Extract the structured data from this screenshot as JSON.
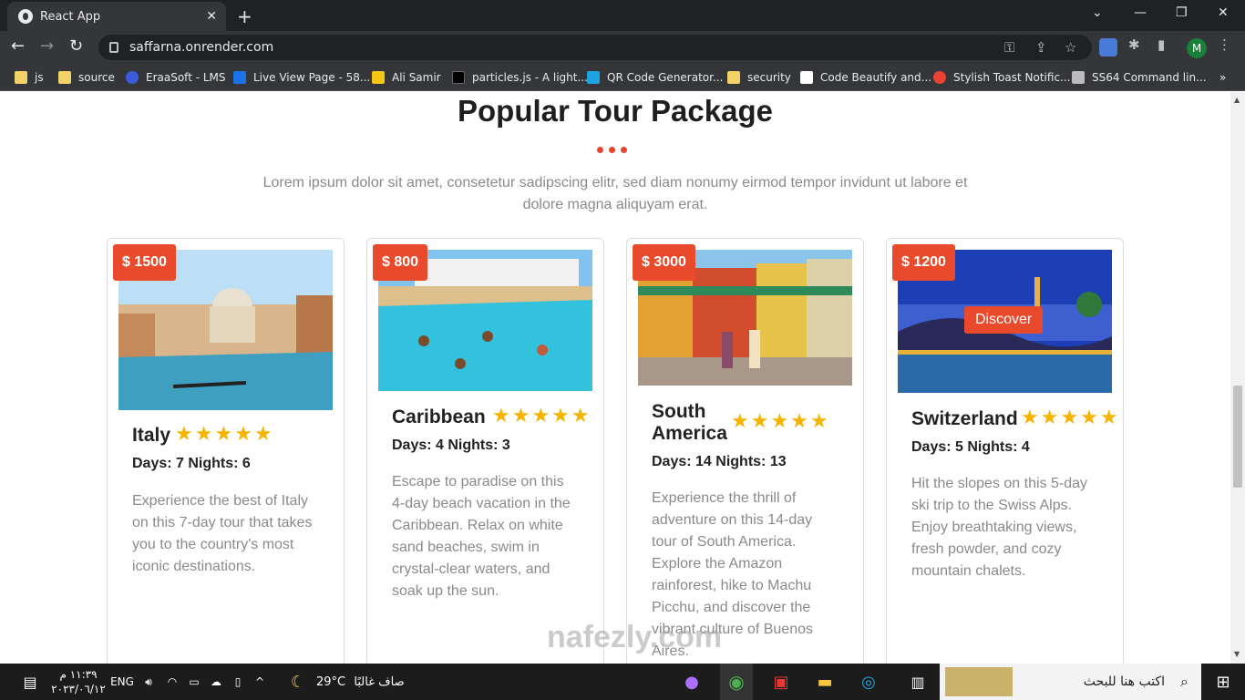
{
  "browser": {
    "tab_title": "React App",
    "tab_close": "✕",
    "new_tab": "+",
    "url": "saffarna.onrender.com",
    "avatar_letter": "M",
    "bookmarks": [
      {
        "label": "js",
        "color": "#f1d168"
      },
      {
        "label": "source",
        "color": "#f1d168"
      },
      {
        "label": "EraaSoft - LMS",
        "color": "#3b5bdb"
      },
      {
        "label": "Live View Page - 58...",
        "color": "#1a73e8"
      },
      {
        "label": "Ali Samir",
        "color": "#f5c518"
      },
      {
        "label": "particles.js - A light...",
        "color": "#000000"
      },
      {
        "label": "QR Code Generator...",
        "color": "#1fa2e0"
      },
      {
        "label": "security",
        "color": "#f1d168"
      },
      {
        "label": "Code Beautify and...",
        "color": "#ffffff"
      },
      {
        "label": "Stylish Toast Notific...",
        "color": "#ea4335"
      },
      {
        "label": "SS64 Command lin...",
        "color": "#bbbbbb"
      }
    ],
    "more_bookmarks": "»"
  },
  "section": {
    "title": "Popular Tour Package",
    "lead": "Lorem ipsum dolor sit amet, consetetur sadipscing elitr, sed diam nonumy eirmod tempor invidunt ut labore et dolore magna aliquyam erat.",
    "accent_color": "#ea4a2c",
    "star_color": "#f5b400"
  },
  "cards": [
    {
      "price": "$ 1500",
      "title": "Italy",
      "stars": "★★★★★",
      "days": "Days: 7 Nights: 6",
      "desc": "Experience the best of Italy on this 7-day tour that takes you to the country's most iconic destinations."
    },
    {
      "price": "$ 800",
      "title": "Caribbean",
      "stars": "★★★★★",
      "days": "Days: 4 Nights: 3",
      "desc": "Escape to paradise on this 4-day beach vacation in the Caribbean. Relax on white sand beaches, swim in crystal-clear waters, and soak up the sun."
    },
    {
      "price": "$ 3000",
      "title": "South America",
      "stars": "★★★★★",
      "days": "Days: 14 Nights: 13",
      "desc": "Experience the thrill of adventure on this 14-day tour of South America. Explore the Amazon rainforest, hike to Machu Picchu, and discover the vibrant culture of Buenos Aires."
    },
    {
      "price": "$ 1200",
      "title": "Switzerland",
      "stars": "★★★★★",
      "days": "Days: 5 Nights: 4",
      "desc": "Hit the slopes on this 5-day ski trip to the Swiss Alps. Enjoy breathtaking views, fresh powder, and cozy mountain chalets.",
      "button": "Discover"
    }
  ],
  "taskbar": {
    "time": "١١:٣٩ م",
    "date": "٢٠٢٣/٠٦/١٢",
    "lang": "ENG",
    "weather_temp": "29°C",
    "weather_text": "صاف غالبًا",
    "search_placeholder": "اكتب هنا للبحث"
  },
  "watermark": "nafezly.com"
}
